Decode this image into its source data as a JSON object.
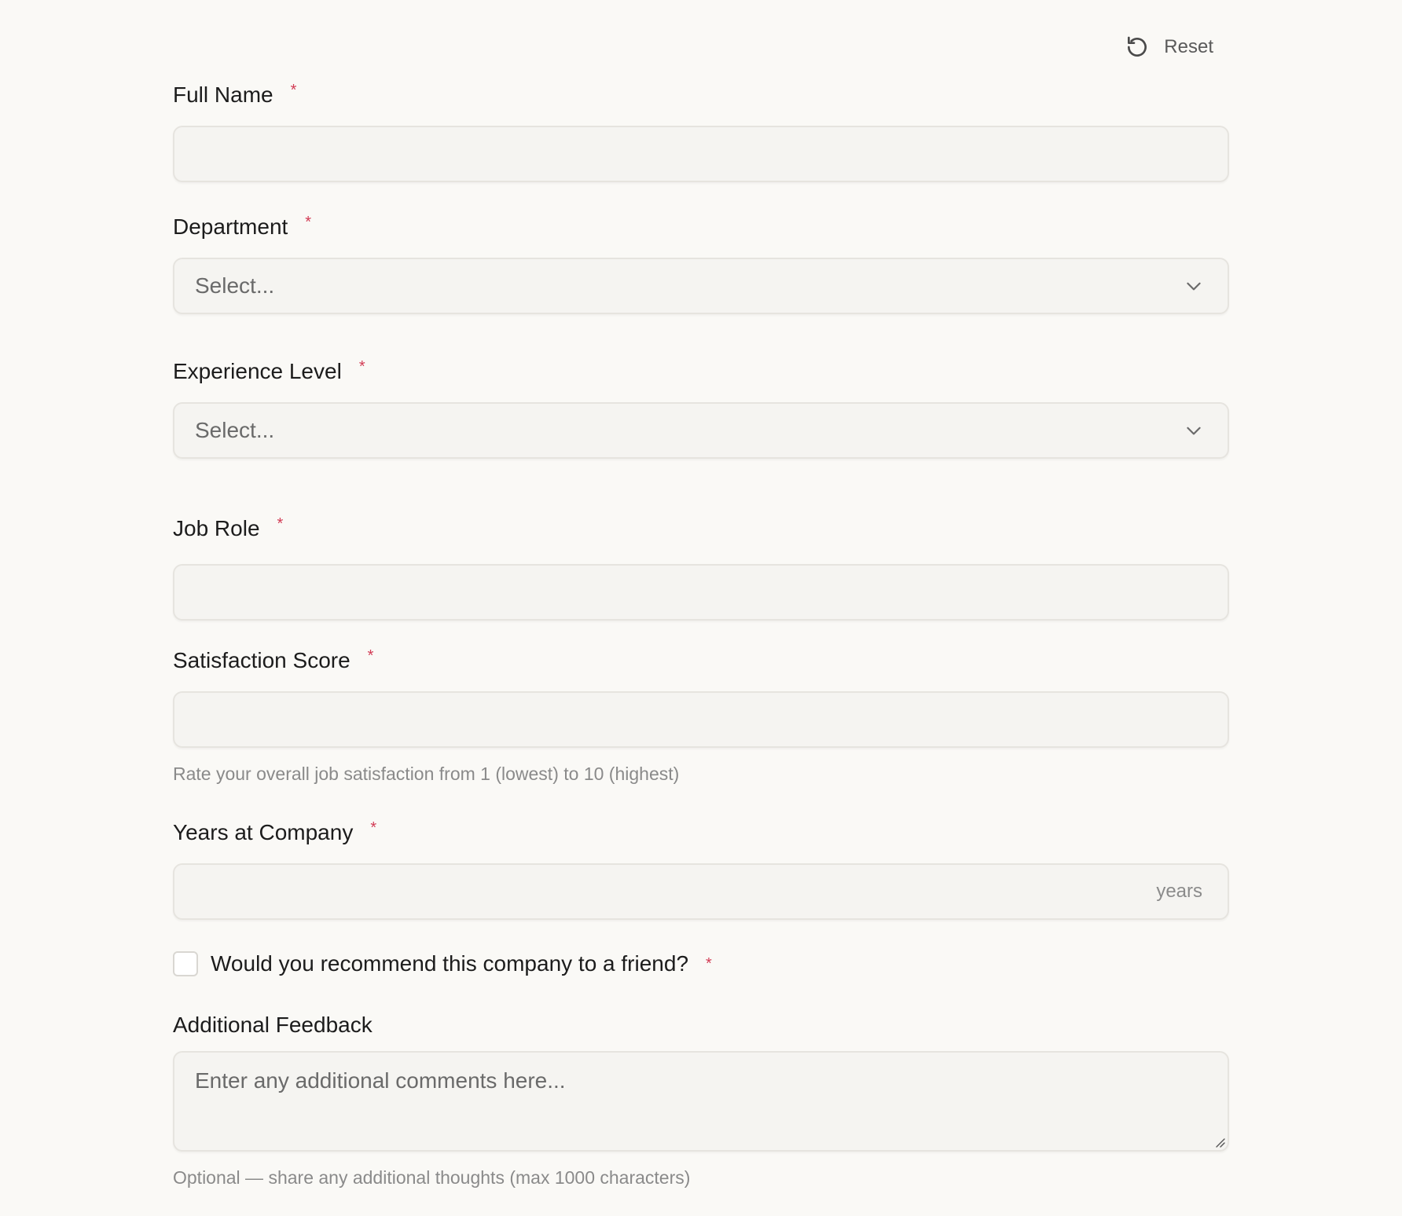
{
  "reset": {
    "label": "Reset",
    "icon": "reset-icon"
  },
  "required_marker": "*",
  "fields": {
    "full_name": {
      "label": "Full Name",
      "value": ""
    },
    "department": {
      "label": "Department",
      "selected": "Select..."
    },
    "experience_level": {
      "label": "Experience Level",
      "selected": "Select..."
    },
    "job_role": {
      "label": "Job Role",
      "value": ""
    },
    "satisfaction_score": {
      "label": "Satisfaction Score",
      "value": "",
      "help": "Rate your overall job satisfaction from 1 (lowest) to 10 (highest)"
    },
    "years_at_company": {
      "label": "Years at Company",
      "value": "",
      "suffix": "years"
    },
    "recommend": {
      "label": "Would you recommend this company to a friend?",
      "checked": false
    },
    "additional_feedback": {
      "label": "Additional Feedback",
      "placeholder": "Enter any additional comments here...",
      "help": "Optional — share any additional thoughts (max 1000 characters)"
    }
  },
  "colors": {
    "background": "#faf9f6",
    "field_background": "#f5f4f1",
    "field_border": "#e6e4df",
    "required": "#d23c55",
    "help_text": "#8a8a8a"
  }
}
